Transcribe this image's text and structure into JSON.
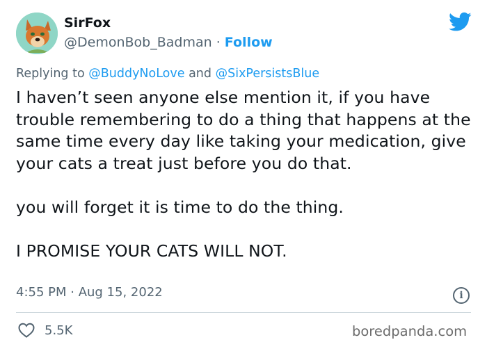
{
  "author": {
    "name": "SirFox",
    "handle": "@DemonBob_Badman",
    "separator": "·",
    "follow_label": "Follow"
  },
  "reply": {
    "prefix": "Replying to",
    "mention_1": "@BuddyNoLove",
    "conjunction": "and",
    "mention_2": "@SixPersistsBlue"
  },
  "tweet": {
    "paragraph_1": "I haven’t seen anyone else mention it, if you have trouble remembering to do a thing that happens at the same time every day like taking your medication, give your cats a treat just before you do that.",
    "paragraph_2": "you will forget it is time to do the thing.",
    "paragraph_3": "I PROMISE YOUR CATS WILL NOT."
  },
  "meta": {
    "timestamp": "4:55 PM · Aug 15, 2022",
    "info_icon": "info-icon"
  },
  "stats": {
    "likes": "5.5K",
    "like_icon": "heart-icon"
  },
  "watermark": "boredpanda.com",
  "colors": {
    "accent": "#1d9bf0",
    "text": "#0f1419",
    "muted": "#536471",
    "divider": "#cfd9de"
  }
}
